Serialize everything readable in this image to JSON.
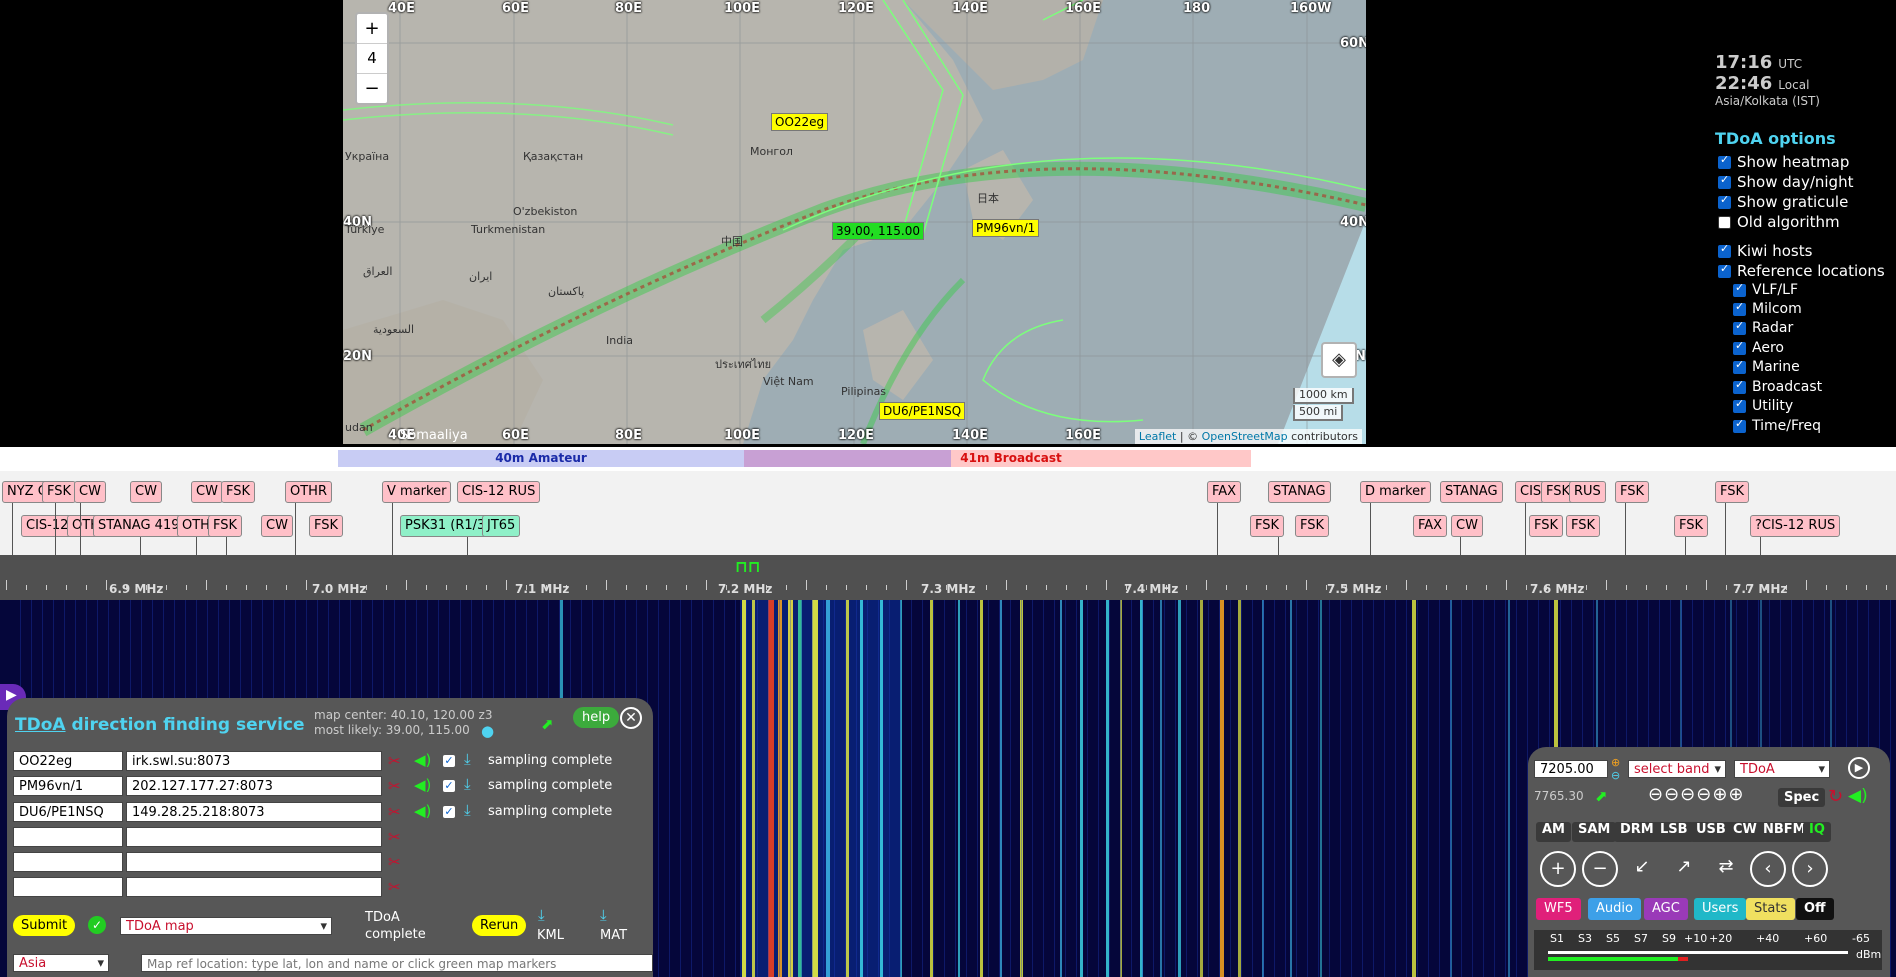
{
  "map": {
    "zoom": "4",
    "zoom_in": "+",
    "zoom_out": "−",
    "coords_top": [
      "40E",
      "60E",
      "80E",
      "100E",
      "120E",
      "140E",
      "160E",
      "180",
      "160W"
    ],
    "coords_bottom": [
      "40E",
      "60E",
      "80E",
      "100E",
      "120E",
      "140E",
      "160E"
    ],
    "coords_left": [
      "40N",
      "20N"
    ],
    "coords_right": [
      "60N",
      "40N",
      "N"
    ],
    "place_labels": [
      "Україна",
      "Қазақстан",
      "Монгол",
      "O'zbekiston",
      "Turkmenistan",
      "Türkiye",
      "中国",
      "India",
      "日本",
      "العراق",
      "ایران",
      "پاکستان",
      "السعودية",
      "Việt Nam",
      "Pilipinas",
      "Somaaliya",
      "udan",
      "ประเทศไทย"
    ],
    "markers": {
      "a": "OO22eg",
      "b": "PM96vn/1",
      "c": "39.00, 115.00",
      "d": "DU6/PE1NSQ"
    },
    "scale_km": "1000 km",
    "scale_mi": "500 mi",
    "attrib_leaflet": "Leaflet",
    "attrib_sep": " | © ",
    "attrib_osm": "OpenStreetMap",
    "attrib_contrib": " contributors"
  },
  "clock": {
    "utc_time": "17:16",
    "utc_label": "UTC",
    "local_time": "22:46",
    "local_label": "Local",
    "tz": "Asia/Kolkata (IST)"
  },
  "options": {
    "title": "TDoA options",
    "items": [
      "Show heatmap",
      "Show day/night",
      "Show graticule",
      "Old algorithm",
      "Kiwi hosts",
      "Reference locations"
    ],
    "sub_items": [
      "VLF/LF",
      "Milcom",
      "Radar",
      "Aero",
      "Marine",
      "Broadcast",
      "Utility",
      "Time/Freq"
    ]
  },
  "bands": {
    "amateur": "40m Amateur",
    "broadcast": "41m Broadcast"
  },
  "tags_row1": [
    "NYZ C",
    "FSK",
    "CW",
    "CW",
    "CW",
    "FSK",
    "OTHR",
    "V marker",
    "CIS-12 RUS",
    "FAX",
    "STANAG",
    "D marker",
    "STANAG",
    "CIS",
    "FSK",
    "RUS",
    "FSK",
    "FSK"
  ],
  "tags_row2": [
    "CIS-12",
    "OTH",
    "STANAG 419",
    "OTH",
    "FSK",
    "CW",
    "FSK",
    "PSK31 (R1/3",
    "JT65",
    "FSK",
    "FSK",
    "FAX",
    "CW",
    "FSK",
    "FSK",
    "FSK",
    "?CIS-12 RUS"
  ],
  "freq_labels": [
    "6.9 MHz",
    "7.0 MHz",
    "7.1 MHz",
    "7.2 MHz",
    "7.3 MHz",
    "7.4 MHz",
    "7.5 MHz",
    "7.6 MHz",
    "7.7 MHz"
  ],
  "tdoa": {
    "title_link": "TDoA",
    "title_rest": " direction finding service",
    "map_center": "map center: 40.10, 120.00 z3",
    "most_likely": "most likely: 39.00, 115.00",
    "help": "help",
    "hosts": [
      {
        "name": "OO22eg",
        "url": "irk.swl.su:8073",
        "status": "sampling complete"
      },
      {
        "name": "PM96vn/1",
        "url": "202.127.177.27:8073",
        "status": "sampling complete"
      },
      {
        "name": "DU6/PE1NSQ",
        "url": "149.28.25.218:8073",
        "status": "sampling complete"
      }
    ],
    "submit": "Submit",
    "map_select": "TDoA map",
    "complete_1": "TDoA",
    "complete_2": "complete",
    "rerun": "Rerun",
    "kml": "KML",
    "mat": "MAT",
    "region": "Asia",
    "ref_placeholder": "Map ref location: type lat, lon and name or click green map markers"
  },
  "control": {
    "freq": "7205.00",
    "select_band": "select band",
    "mode_select": "TDoA",
    "freq2": "7765.30",
    "spec": "Spec",
    "modes": [
      "AM",
      "SAM",
      "DRM",
      "LSB",
      "USB",
      "CW",
      "NBFM",
      "IQ"
    ],
    "buttons": [
      "WF5",
      "Audio",
      "AGC",
      "Users",
      "Stats",
      "Off"
    ],
    "smeter": [
      "S1",
      "S3",
      "S5",
      "S7",
      "S9",
      "+10",
      "+20",
      "+40",
      "+60",
      "-65"
    ],
    "smeter_unit": "dBm"
  },
  "colors": {
    "accent": "#4fd3f0",
    "marker_yellow": "#ffff00",
    "marker_green": "#22dd22",
    "tag_pink": "#ffc0c8",
    "tag_green": "#8ff0c8"
  }
}
